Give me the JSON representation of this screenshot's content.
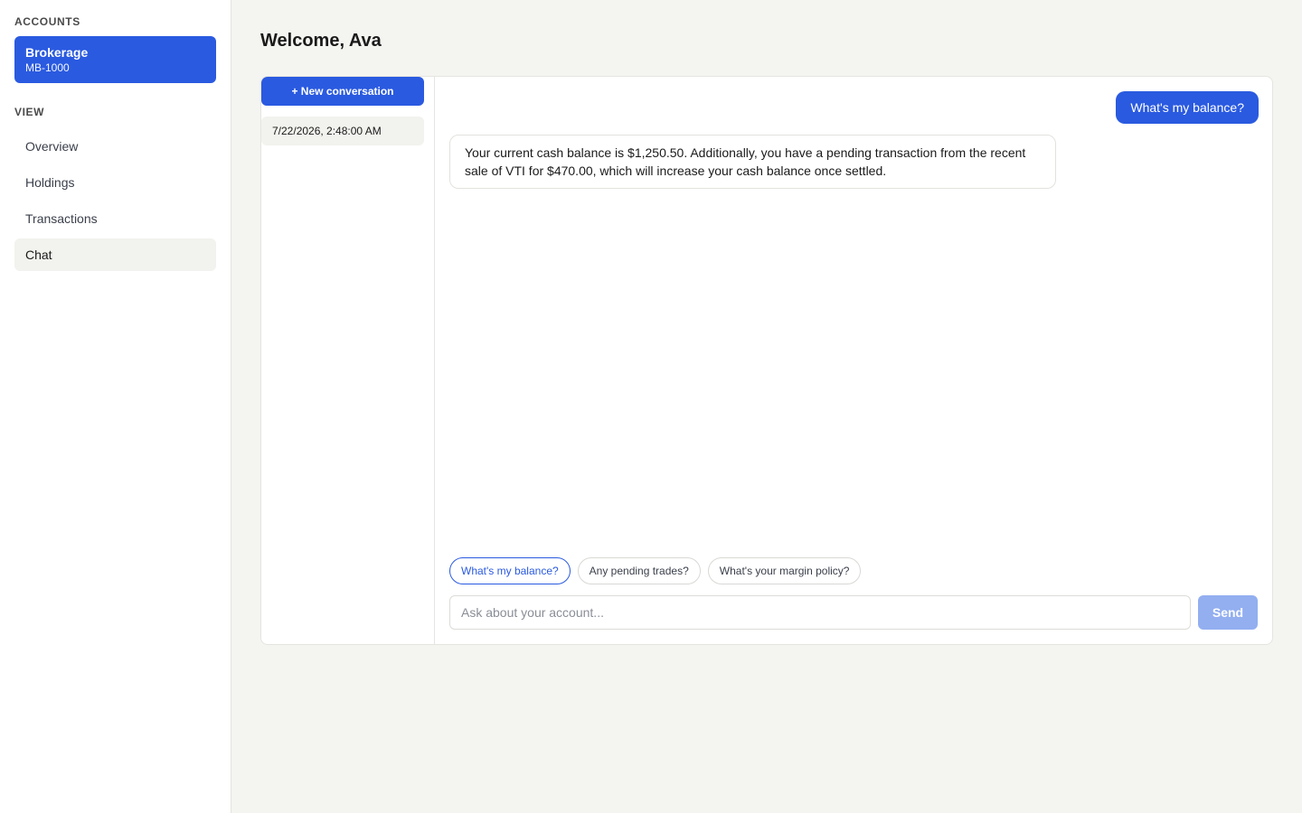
{
  "sidebar": {
    "accounts_label": "ACCOUNTS",
    "account": {
      "name": "Brokerage",
      "id": "MB-1000"
    },
    "view_label": "VIEW",
    "nav": [
      {
        "label": "Overview"
      },
      {
        "label": "Holdings"
      },
      {
        "label": "Transactions"
      },
      {
        "label": "Chat",
        "active": true
      }
    ]
  },
  "main": {
    "title": "Welcome, Ava",
    "new_conversation_label": "+ New conversation",
    "conversations": [
      {
        "label": "7/22/2026, 2:48:00 AM",
        "active": true
      }
    ],
    "messages": [
      {
        "role": "user",
        "text": "What's my balance?"
      },
      {
        "role": "assistant",
        "text": "Your current cash balance is $1,250.50. Additionally, you have a pending transaction from the recent sale of VTI for $470.00, which will increase your cash balance once settled."
      }
    ],
    "suggestions": [
      {
        "label": "What's my balance?",
        "selected": true
      },
      {
        "label": "Any pending trades?"
      },
      {
        "label": "What's your margin policy?"
      }
    ],
    "input": {
      "placeholder": "Ask about your account...",
      "value": ""
    },
    "send_label": "Send"
  },
  "colors": {
    "accent": "#2a5ae0",
    "accent_disabled": "#93aff0",
    "page_background": "#f4f4f0",
    "panel_background": "#ffffff"
  }
}
